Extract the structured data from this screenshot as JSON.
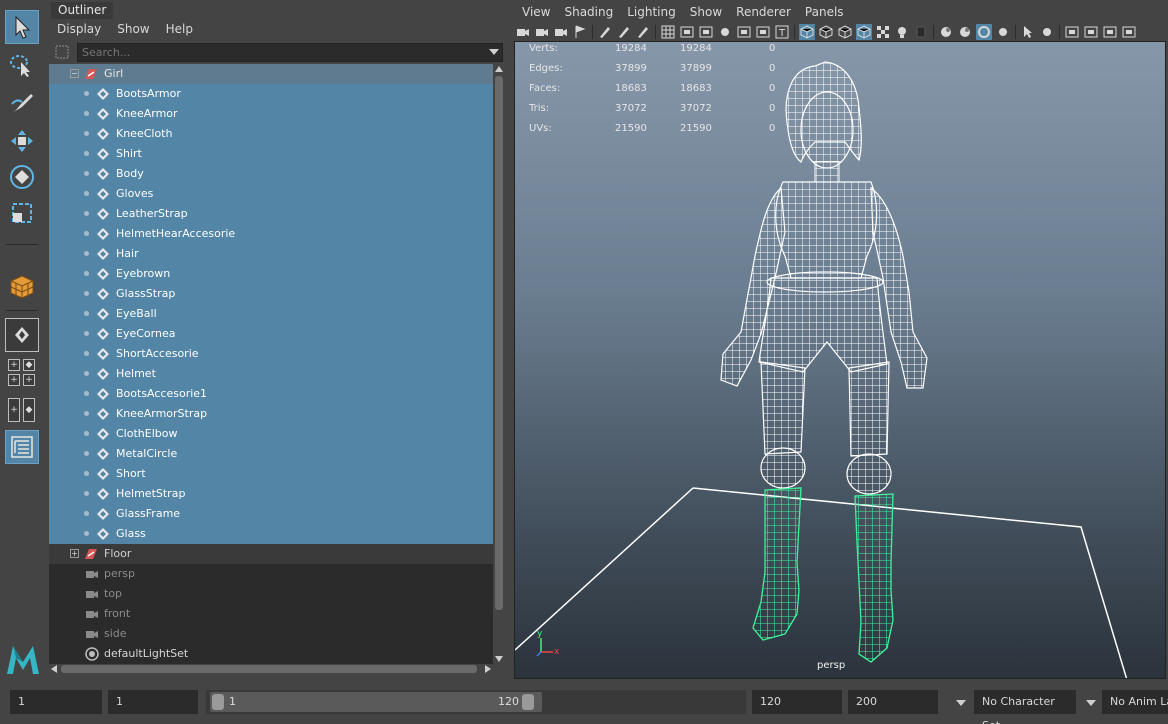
{
  "outliner": {
    "tab_title": "Outliner",
    "menu": [
      "Display",
      "Show",
      "Help"
    ],
    "search_placeholder": "Search...",
    "group_girl": "Girl",
    "girl_children": [
      "BootsArmor",
      "KneeArmor",
      "KneeCloth",
      "Shirt",
      "Body",
      "Gloves",
      "LeatherStrap",
      "HelmetHearAccesorie",
      "Hair",
      "Eyebrown",
      "GlassStrap",
      "EyeBall",
      "EyeCornea",
      "ShortAccesorie",
      "Helmet",
      "BootsAccesorie1",
      "KneeArmorStrap",
      "ClothElbow",
      "MetalCircle",
      "Short",
      "HelmetStrap",
      "GlassFrame",
      "Glass"
    ],
    "group_floor": "Floor",
    "cameras": [
      "persp",
      "top",
      "front",
      "side"
    ],
    "light_set": "defaultLightSet"
  },
  "viewport": {
    "menu": [
      "View",
      "Shading",
      "Lighting",
      "Show",
      "Renderer",
      "Panels"
    ],
    "hud": [
      {
        "label": "Verts:",
        "a": "19284",
        "b": "19284",
        "c": "0"
      },
      {
        "label": "Edges:",
        "a": "37899",
        "b": "37899",
        "c": "0"
      },
      {
        "label": "Faces:",
        "a": "18683",
        "b": "18683",
        "c": "0"
      },
      {
        "label": "Tris:",
        "a": "37072",
        "b": "37072",
        "c": "0"
      },
      {
        "label": "UVs:",
        "a": "21590",
        "b": "21590",
        "c": "0"
      }
    ],
    "camera": "persp",
    "axis_x": "x",
    "axis_y": "y",
    "colors": {
      "wire": "#ffffff",
      "selected_wire": "#3ef29a",
      "selection": "#5285a6"
    }
  },
  "timeline": {
    "start_frame": "1",
    "current_frame": "1",
    "range_start": "1",
    "range_end": "120",
    "end_frame": "120",
    "anim_end": "200",
    "character_set": "No Character Set",
    "anim_layer": "No Anim La"
  },
  "icons": [
    "select-arrow-icon",
    "lasso-icon",
    "paint-select-icon",
    "move-icon",
    "rotate-icon",
    "scale-icon",
    "cube-icon",
    "maya-logo-icon"
  ]
}
